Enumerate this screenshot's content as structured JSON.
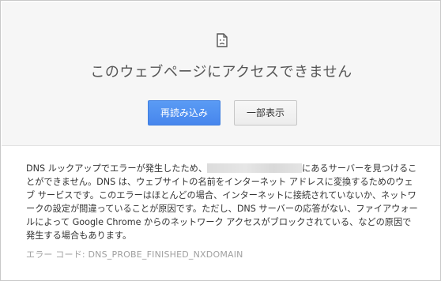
{
  "page": {
    "title": "このウェブページにアクセスできません",
    "icon": "sad-page-icon"
  },
  "buttons": {
    "reload_label": "再読み込み",
    "details_label": "一部表示"
  },
  "details": {
    "text_before_redaction": "DNS ルックアップでエラーが発生したため、",
    "text_after_redaction": "にあるサーバーを見つけることができません。DNS は、ウェブサイトの名前をインターネット アドレスに変換するためのウェブ サービスです。このエラーはほとんどの場合、インターネットに接続されていないか、ネットワークの設定が間違っていることが原因です。ただし、DNS サーバーの応答がない、ファイアウォールによって Google Chrome からのネットワーク アクセスがブロックされている、などの原因で発生する場合もあります。"
  },
  "error_code": "エラー コード: DNS_PROBE_FINISHED_NXDOMAIN",
  "colors": {
    "primary_button": "#4786ed",
    "top_background": "#f6f6f6",
    "error_code_text": "#a0a0a0"
  }
}
